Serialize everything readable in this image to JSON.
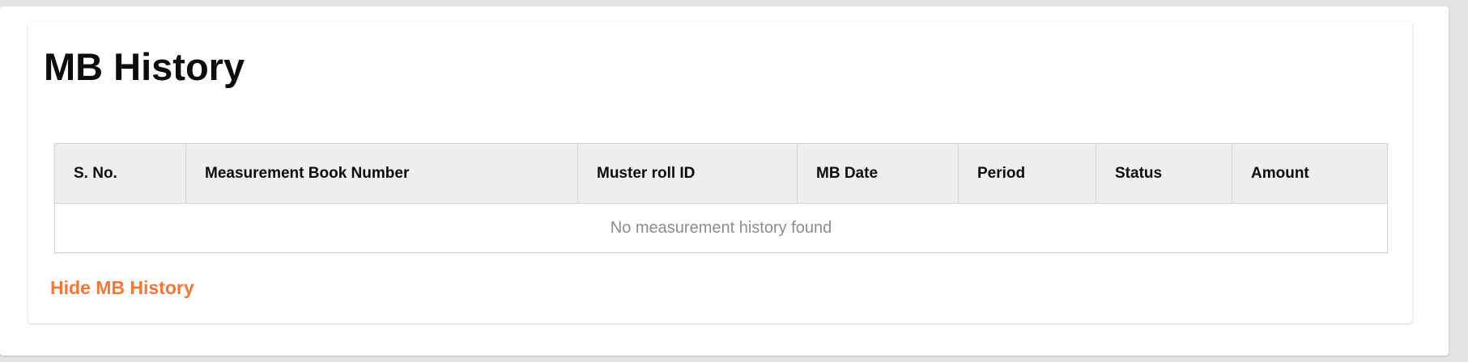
{
  "page": {
    "title": "MB History"
  },
  "table": {
    "columns": [
      "S. No.",
      "Measurement Book Number",
      "Muster roll ID",
      "MB Date",
      "Period",
      "Status",
      "Amount"
    ],
    "empty_message": "No measurement history found"
  },
  "actions": {
    "toggle_history_label": "Hide MB History"
  },
  "colors": {
    "accent": "#f47738",
    "header_background": "#eeeeee",
    "page_background": "#e3e3e3",
    "muted_text": "#8c8c8c"
  }
}
